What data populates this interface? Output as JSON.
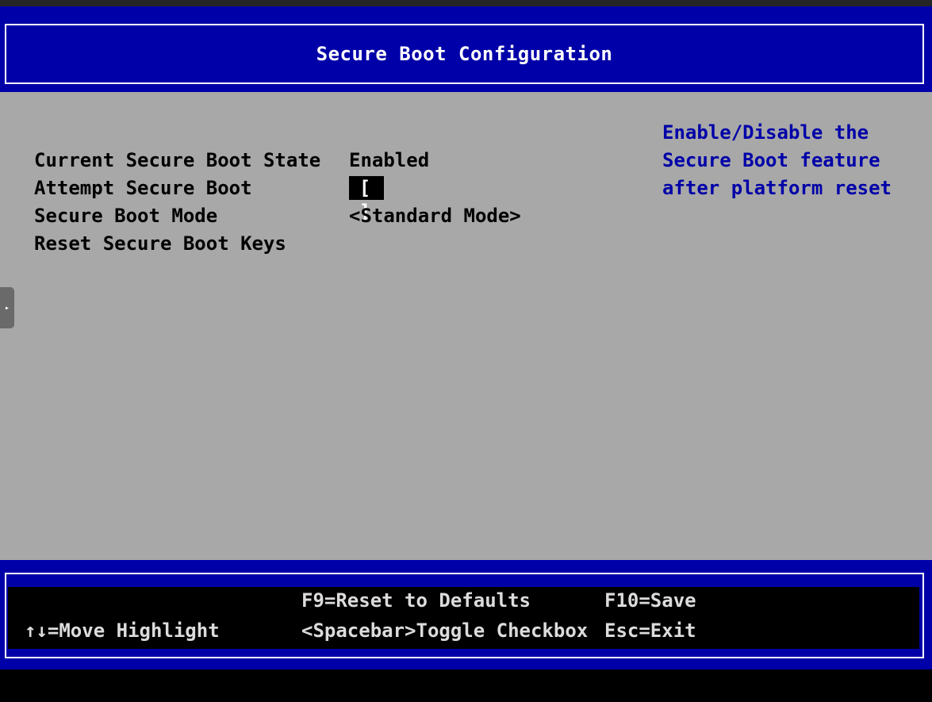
{
  "header": {
    "title": "Secure Boot Configuration"
  },
  "settings": [
    {
      "label": "Current Secure Boot State",
      "value": "Enabled"
    },
    {
      "label": "Attempt Secure Boot",
      "value": "[ ]"
    },
    {
      "label": "Secure Boot Mode",
      "value": "<Standard Mode>"
    },
    {
      "label": "Reset Secure Boot Keys",
      "value": ""
    }
  ],
  "help": {
    "lines": [
      "Enable/Disable the",
      "Secure Boot feature",
      "after platform reset"
    ]
  },
  "footer": {
    "reset_defaults": "F9=Reset to Defaults",
    "save": "F10=Save",
    "move_highlight": "↑↓=Move Highlight",
    "toggle_checkbox": "<Spacebar>Toggle Checkbox",
    "exit": "Esc=Exit"
  },
  "colors": {
    "header_bg": "#0000a8",
    "body_bg": "#a8a8a8",
    "help_text": "#0000a8",
    "footer_bg": "#000000"
  }
}
